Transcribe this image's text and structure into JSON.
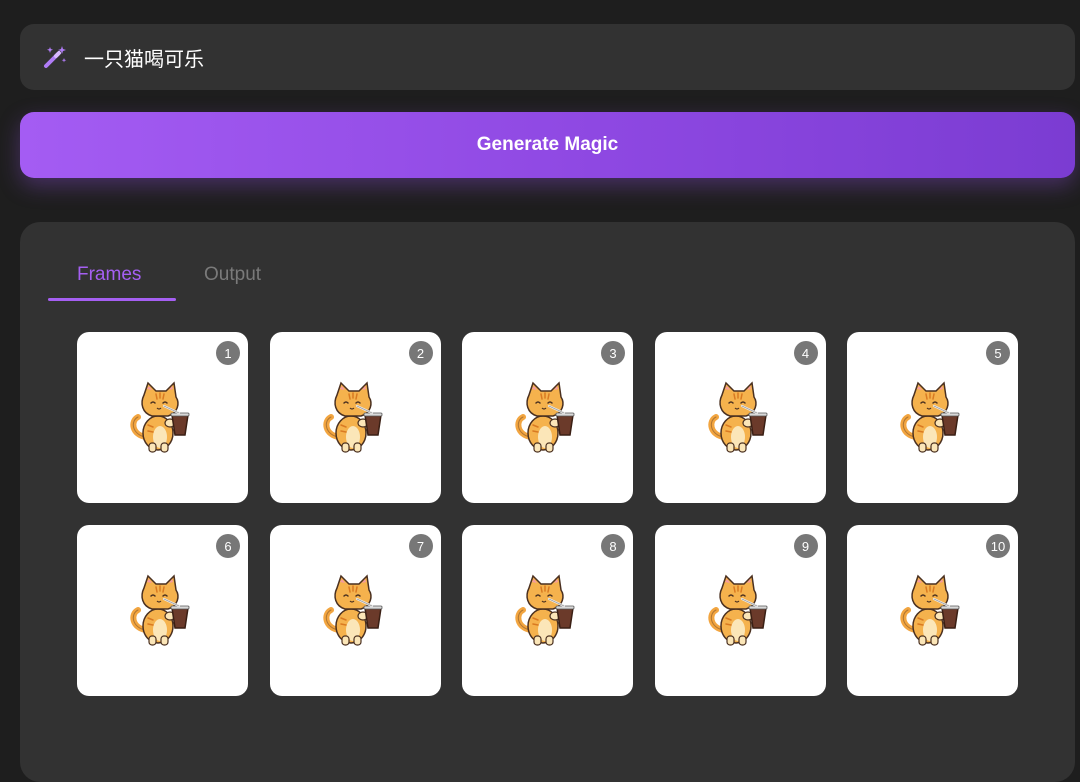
{
  "prompt": {
    "icon": "magic-wand-icon",
    "text": "一只猫喝可乐"
  },
  "generate_button": {
    "label": "Generate Magic"
  },
  "tabs": [
    {
      "label": "Frames",
      "active": true
    },
    {
      "label": "Output",
      "active": false
    }
  ],
  "frames": [
    {
      "number": "1"
    },
    {
      "number": "2"
    },
    {
      "number": "3"
    },
    {
      "number": "4"
    },
    {
      "number": "5"
    },
    {
      "number": "6"
    },
    {
      "number": "7"
    },
    {
      "number": "8"
    },
    {
      "number": "9"
    },
    {
      "number": "10"
    }
  ],
  "colors": {
    "accent": "#a55ff2",
    "background": "#1e1e1e",
    "panel": "#323232"
  }
}
